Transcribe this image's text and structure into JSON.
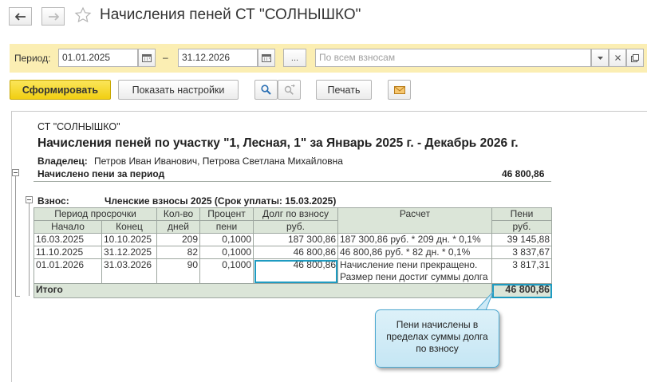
{
  "window": {
    "title": "Начисления пеней СТ \"СОЛНЫШКО\""
  },
  "period": {
    "label": "Период:",
    "date_from": "01.01.2025",
    "dash": "–",
    "date_to": "31.12.2026",
    "ellipsis": "...",
    "fees_placeholder": "По всем взносам"
  },
  "toolbar": {
    "generate": "Сформировать",
    "show_settings": "Показать настройки",
    "print": "Печать"
  },
  "report": {
    "org": "СТ \"СОЛНЫШКО\"",
    "heading": "Начисления пеней по участку \"1, Лесная, 1\"  за Январь 2025 г. - Декабрь 2026 г.",
    "owner_label": "Владелец:",
    "owner_value": "Петров Иван Иванович, Петрова Светлана Михайловна",
    "total_accrued_label": "Начислено пени за период",
    "total_accrued_value": "46 800,86",
    "fee_label": "Взнос:",
    "fee_value": "Членские взносы 2025 (Срок уплаты: 15.03.2025)",
    "columns": {
      "overdue_period": "Период просрочки",
      "start": "Начало",
      "end": "Конец",
      "days_1": "Кол-во",
      "days_2": "дней",
      "percent_1": "Процент",
      "percent_2": "пени",
      "debt_1": "Долг по взносу",
      "debt_2": "руб.",
      "calc": "Расчет",
      "penalty_1": "Пени",
      "penalty_2": "руб."
    },
    "rows": [
      {
        "start": "16.03.2025",
        "end": "10.10.2025",
        "days": "209",
        "percent": "0,1000",
        "debt": "187 300,86",
        "calc": "187 300,86 руб. * 209 дн. * 0,1%",
        "penalty": "39 145,88"
      },
      {
        "start": "11.10.2025",
        "end": "31.12.2025",
        "days": "82",
        "percent": "0,1000",
        "debt": "46 800,86",
        "calc": "46 800,86 руб. * 82 дн. * 0,1%",
        "penalty": "3 837,67"
      },
      {
        "start": "01.01.2026",
        "end": "31.03.2026",
        "days": "90",
        "percent": "0,1000",
        "debt": "46 800,86",
        "calc": "Начисление пени прекращено.",
        "calc_2": "Размер пени достиг суммы долга",
        "penalty": "3 817,31"
      }
    ],
    "total_label": "Итого",
    "total_value": "46 800,86"
  },
  "callout": {
    "line1": "Пени начислены в",
    "line2": "пределах суммы долга",
    "line3": "по взносу"
  },
  "colors": {
    "period_panel": "#fbeeb3",
    "primary_button": "#f1cf12",
    "table_header": "#dbe5d8",
    "highlight_border": "#1e9bc1",
    "callout_bg": "#cfeaf6"
  }
}
